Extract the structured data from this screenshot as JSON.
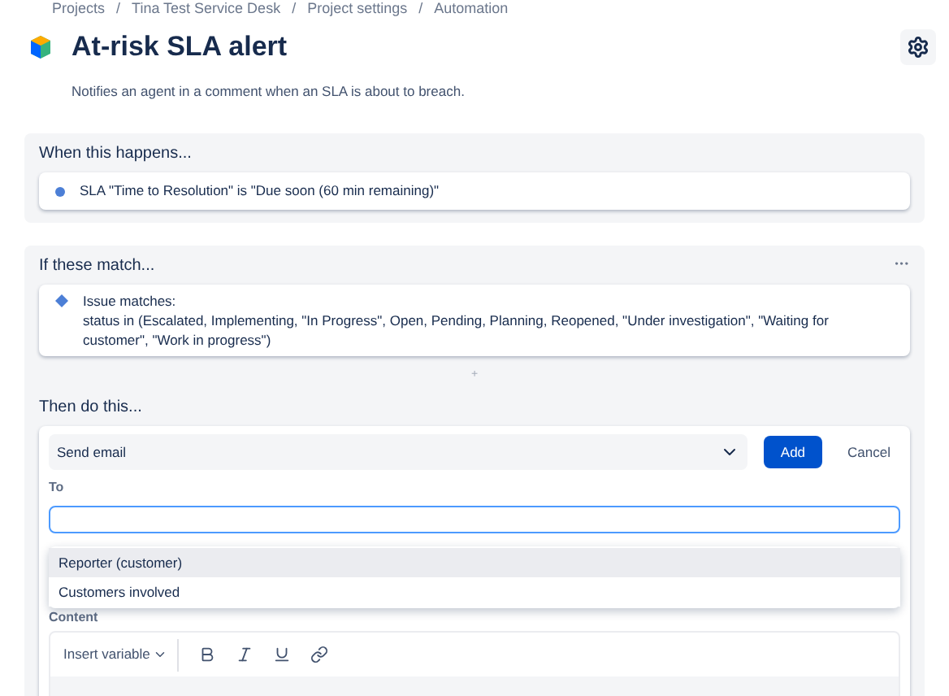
{
  "breadcrumbs": [
    "Projects",
    "Tina Test Service Desk",
    "Project settings",
    "Automation"
  ],
  "breadcrumb_separator": "/",
  "title": "At-risk SLA alert",
  "description": "Notifies an agent in a comment when an SLA is about to breach.",
  "trigger": {
    "heading": "When this happens...",
    "text": "SLA \"Time to Resolution\" is \"Due soon (60 min remaining)\""
  },
  "condition": {
    "heading": "If these match...",
    "more": "•••",
    "label": "Issue matches:",
    "text": "status in (Escalated, Implementing, \"In Progress\", Open, Pending, Planning, Reopened, \"Under investigation\", \"Waiting for customer\", \"Work in progress\")"
  },
  "add_marker": "+",
  "action": {
    "heading": "Then do this...",
    "select_value": "Send email",
    "add_button": "Add",
    "cancel_button": "Cancel",
    "to_label": "To",
    "suggestions": [
      {
        "label": "Reporter (customer)",
        "selected": true
      },
      {
        "label": "Customers involved",
        "selected": false
      }
    ],
    "content_label": "Content",
    "insert_variable": "Insert variable"
  }
}
